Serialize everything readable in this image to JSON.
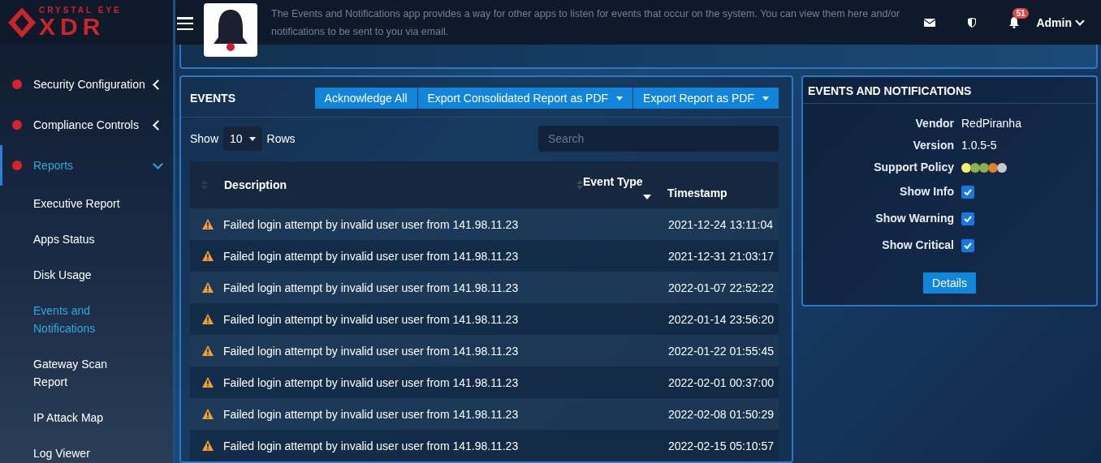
{
  "brand": {
    "top": "CRYSTAL EYE",
    "main": "XDR"
  },
  "app_intro": {
    "line_1": "The Events and Notifications app provides a way for other apps to listen for events that occur on the system. You can view them here and/or",
    "line_2": "notifications to be sent to you via email."
  },
  "topbar": {
    "notification_count": "51",
    "user": "Admin"
  },
  "sidebar": {
    "items": [
      {
        "label": "Security Configuration",
        "kind": "section",
        "expanded": false,
        "selected": false
      },
      {
        "label": "Compliance Controls",
        "kind": "section",
        "expanded": false,
        "selected": false
      },
      {
        "label": "Reports",
        "kind": "section",
        "expanded": true,
        "selected": true
      },
      {
        "label": "Executive Report",
        "kind": "sub",
        "selected": false
      },
      {
        "label": "Apps Status",
        "kind": "sub",
        "selected": false
      },
      {
        "label": "Disk Usage",
        "kind": "sub",
        "selected": false
      },
      {
        "label": "Events and Notifications",
        "kind": "sub",
        "selected": true
      },
      {
        "label": "Gateway Scan Report",
        "kind": "sub",
        "selected": false
      },
      {
        "label": "IP Attack Map",
        "kind": "sub",
        "selected": false
      },
      {
        "label": "Log Viewer",
        "kind": "sub",
        "selected": false
      }
    ]
  },
  "events": {
    "title": "EVENTS",
    "buttons": [
      {
        "label": "Acknowledge All",
        "dropdown": false
      },
      {
        "label": "Export Consolidated Report as PDF",
        "dropdown": true
      },
      {
        "label": "Export Report as PDF",
        "dropdown": true
      }
    ],
    "show_label": "Show",
    "rows_count": "10",
    "rows_label": "Rows",
    "search": {
      "placeholder": "Search"
    },
    "table": {
      "columns": [
        "Description",
        "Event Type",
        "Timestamp"
      ],
      "rows": [
        {
          "description": "Failed login attempt by invalid user user from 141.98.11.23",
          "timestamp": "2021-12-24 13:11:04"
        },
        {
          "description": "Failed login attempt by invalid user user from 141.98.11.23",
          "timestamp": "2021-12-31 21:03:17"
        },
        {
          "description": "Failed login attempt by invalid user user from 141.98.11.23",
          "timestamp": "2022-01-07 22:52:22"
        },
        {
          "description": "Failed login attempt by invalid user user from 141.98.11.23",
          "timestamp": "2022-01-14 23:56:20"
        },
        {
          "description": "Failed login attempt by invalid user user from 141.98.11.23",
          "timestamp": "2022-01-22 01:55:45"
        },
        {
          "description": "Failed login attempt by invalid user user from 141.98.11.23",
          "timestamp": "2022-02-01 00:37:00"
        },
        {
          "description": "Failed login attempt by invalid user user from 141.98.11.23",
          "timestamp": "2022-02-08 01:50:29"
        },
        {
          "description": "Failed login attempt by invalid user user from 141.98.11.23",
          "timestamp": "2022-02-15 05:10:57"
        }
      ]
    }
  },
  "info": {
    "title": "EVENTS AND NOTIFICATIONS",
    "fields": [
      {
        "label": "Vendor",
        "value": "RedPiranha"
      },
      {
        "label": "Version",
        "value": "1.0.5-5"
      }
    ],
    "support_policy": {
      "label": "Support Policy",
      "dots": [
        {
          "color": "#f2ef6b"
        },
        {
          "color": "#8fb04f"
        },
        {
          "color": "#8fb04f"
        },
        {
          "color": "#e07f2c"
        },
        {
          "color": "#c8c8c8"
        }
      ]
    },
    "toggles": [
      {
        "label": "Show Info",
        "checked": true
      },
      {
        "label": "Show Warning",
        "checked": true
      },
      {
        "label": "Show Critical",
        "checked": true
      }
    ],
    "details_button": "Details"
  }
}
